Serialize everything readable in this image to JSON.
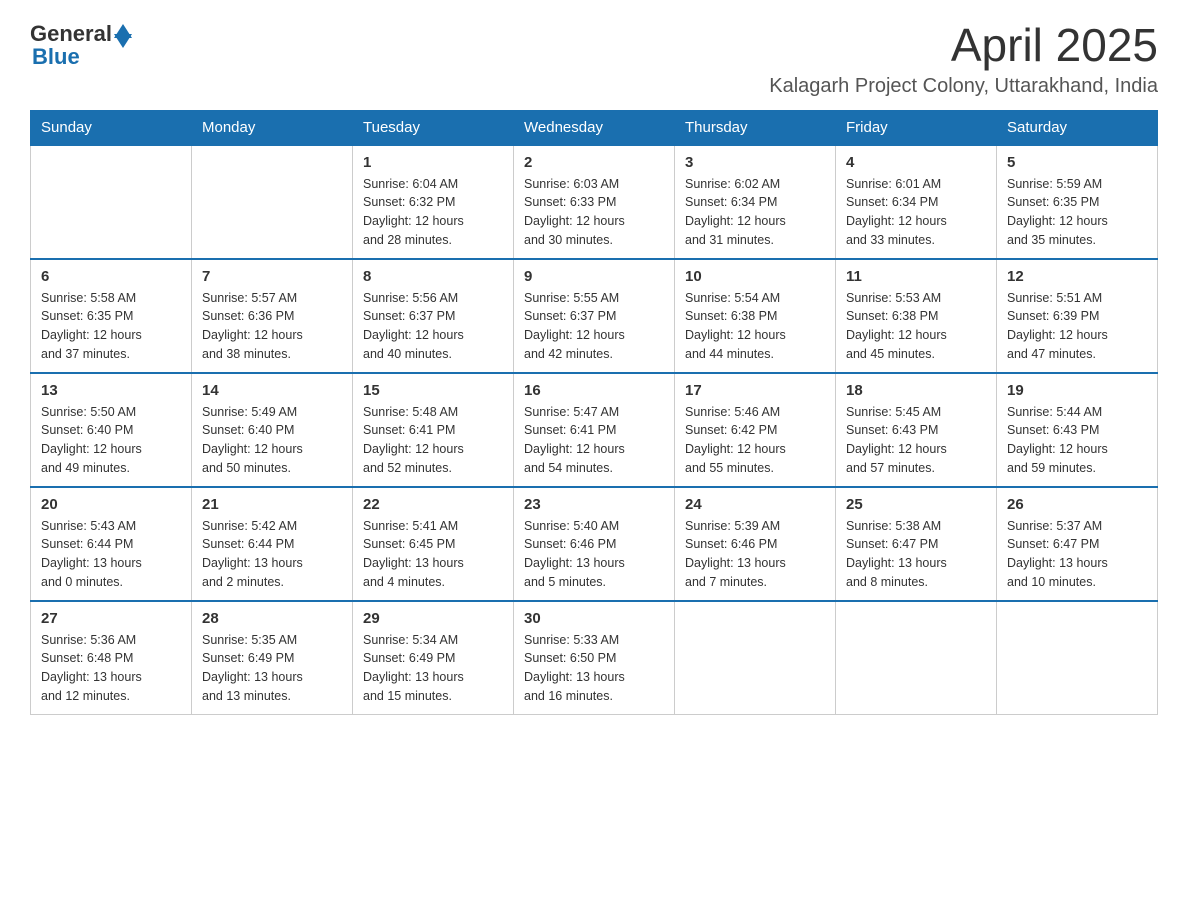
{
  "header": {
    "logo_general": "General",
    "logo_blue": "Blue",
    "month_year": "April 2025",
    "location": "Kalagarh Project Colony, Uttarakhand, India"
  },
  "weekdays": [
    "Sunday",
    "Monday",
    "Tuesday",
    "Wednesday",
    "Thursday",
    "Friday",
    "Saturday"
  ],
  "weeks": [
    [
      {
        "day": "",
        "info": ""
      },
      {
        "day": "",
        "info": ""
      },
      {
        "day": "1",
        "info": "Sunrise: 6:04 AM\nSunset: 6:32 PM\nDaylight: 12 hours\nand 28 minutes."
      },
      {
        "day": "2",
        "info": "Sunrise: 6:03 AM\nSunset: 6:33 PM\nDaylight: 12 hours\nand 30 minutes."
      },
      {
        "day": "3",
        "info": "Sunrise: 6:02 AM\nSunset: 6:34 PM\nDaylight: 12 hours\nand 31 minutes."
      },
      {
        "day": "4",
        "info": "Sunrise: 6:01 AM\nSunset: 6:34 PM\nDaylight: 12 hours\nand 33 minutes."
      },
      {
        "day": "5",
        "info": "Sunrise: 5:59 AM\nSunset: 6:35 PM\nDaylight: 12 hours\nand 35 minutes."
      }
    ],
    [
      {
        "day": "6",
        "info": "Sunrise: 5:58 AM\nSunset: 6:35 PM\nDaylight: 12 hours\nand 37 minutes."
      },
      {
        "day": "7",
        "info": "Sunrise: 5:57 AM\nSunset: 6:36 PM\nDaylight: 12 hours\nand 38 minutes."
      },
      {
        "day": "8",
        "info": "Sunrise: 5:56 AM\nSunset: 6:37 PM\nDaylight: 12 hours\nand 40 minutes."
      },
      {
        "day": "9",
        "info": "Sunrise: 5:55 AM\nSunset: 6:37 PM\nDaylight: 12 hours\nand 42 minutes."
      },
      {
        "day": "10",
        "info": "Sunrise: 5:54 AM\nSunset: 6:38 PM\nDaylight: 12 hours\nand 44 minutes."
      },
      {
        "day": "11",
        "info": "Sunrise: 5:53 AM\nSunset: 6:38 PM\nDaylight: 12 hours\nand 45 minutes."
      },
      {
        "day": "12",
        "info": "Sunrise: 5:51 AM\nSunset: 6:39 PM\nDaylight: 12 hours\nand 47 minutes."
      }
    ],
    [
      {
        "day": "13",
        "info": "Sunrise: 5:50 AM\nSunset: 6:40 PM\nDaylight: 12 hours\nand 49 minutes."
      },
      {
        "day": "14",
        "info": "Sunrise: 5:49 AM\nSunset: 6:40 PM\nDaylight: 12 hours\nand 50 minutes."
      },
      {
        "day": "15",
        "info": "Sunrise: 5:48 AM\nSunset: 6:41 PM\nDaylight: 12 hours\nand 52 minutes."
      },
      {
        "day": "16",
        "info": "Sunrise: 5:47 AM\nSunset: 6:41 PM\nDaylight: 12 hours\nand 54 minutes."
      },
      {
        "day": "17",
        "info": "Sunrise: 5:46 AM\nSunset: 6:42 PM\nDaylight: 12 hours\nand 55 minutes."
      },
      {
        "day": "18",
        "info": "Sunrise: 5:45 AM\nSunset: 6:43 PM\nDaylight: 12 hours\nand 57 minutes."
      },
      {
        "day": "19",
        "info": "Sunrise: 5:44 AM\nSunset: 6:43 PM\nDaylight: 12 hours\nand 59 minutes."
      }
    ],
    [
      {
        "day": "20",
        "info": "Sunrise: 5:43 AM\nSunset: 6:44 PM\nDaylight: 13 hours\nand 0 minutes."
      },
      {
        "day": "21",
        "info": "Sunrise: 5:42 AM\nSunset: 6:44 PM\nDaylight: 13 hours\nand 2 minutes."
      },
      {
        "day": "22",
        "info": "Sunrise: 5:41 AM\nSunset: 6:45 PM\nDaylight: 13 hours\nand 4 minutes."
      },
      {
        "day": "23",
        "info": "Sunrise: 5:40 AM\nSunset: 6:46 PM\nDaylight: 13 hours\nand 5 minutes."
      },
      {
        "day": "24",
        "info": "Sunrise: 5:39 AM\nSunset: 6:46 PM\nDaylight: 13 hours\nand 7 minutes."
      },
      {
        "day": "25",
        "info": "Sunrise: 5:38 AM\nSunset: 6:47 PM\nDaylight: 13 hours\nand 8 minutes."
      },
      {
        "day": "26",
        "info": "Sunrise: 5:37 AM\nSunset: 6:47 PM\nDaylight: 13 hours\nand 10 minutes."
      }
    ],
    [
      {
        "day": "27",
        "info": "Sunrise: 5:36 AM\nSunset: 6:48 PM\nDaylight: 13 hours\nand 12 minutes."
      },
      {
        "day": "28",
        "info": "Sunrise: 5:35 AM\nSunset: 6:49 PM\nDaylight: 13 hours\nand 13 minutes."
      },
      {
        "day": "29",
        "info": "Sunrise: 5:34 AM\nSunset: 6:49 PM\nDaylight: 13 hours\nand 15 minutes."
      },
      {
        "day": "30",
        "info": "Sunrise: 5:33 AM\nSunset: 6:50 PM\nDaylight: 13 hours\nand 16 minutes."
      },
      {
        "day": "",
        "info": ""
      },
      {
        "day": "",
        "info": ""
      },
      {
        "day": "",
        "info": ""
      }
    ]
  ]
}
